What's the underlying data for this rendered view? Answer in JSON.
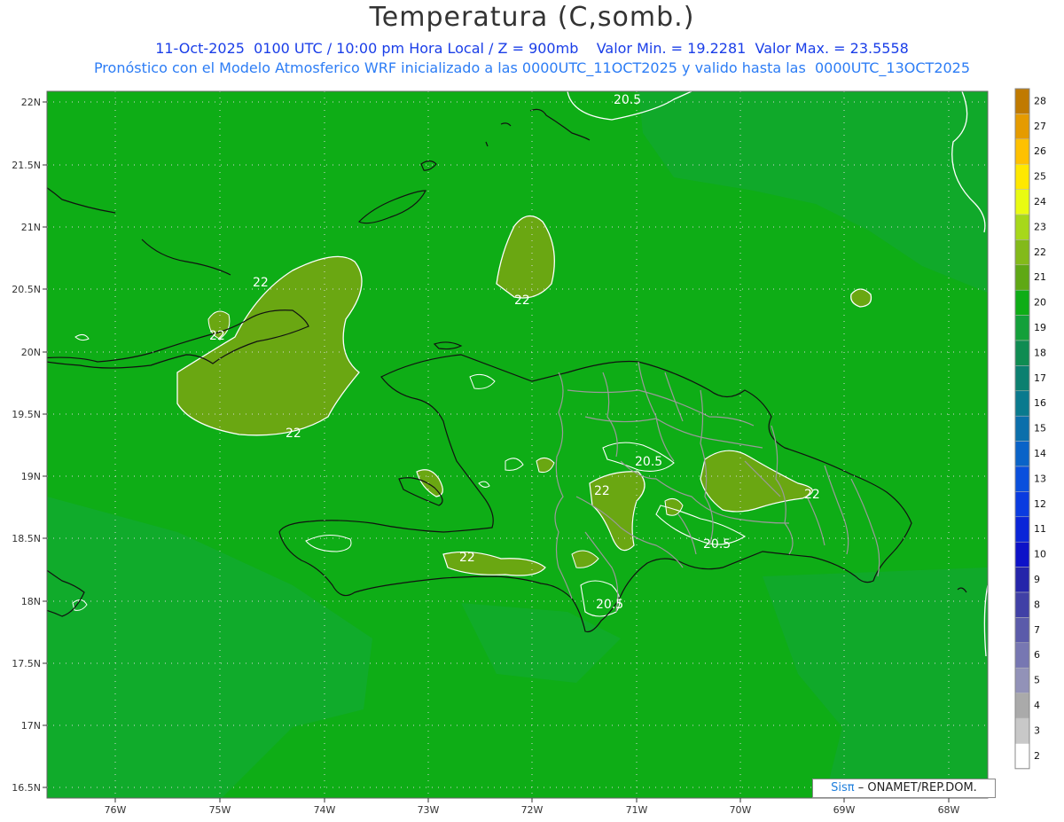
{
  "title": "Temperatura (C,somb.)",
  "subtitle_line1": "11-Oct-2025  0100 UTC / 10:00 pm Hora Local / Z = 900mb    Valor Min. = 19.2281  Valor Max. = 23.5558",
  "subtitle_line2": "Pronóstico con el Modelo Atmosferico WRF inicializado a las 0000UTC_11OCT2025 y valido hasta las  0000UTC_13OCT2025",
  "credit": {
    "sis": "Sisπ",
    "rest": "– ONAMET/REP.DOM."
  },
  "map": {
    "lon_range": [
      -76.65,
      -67.6
    ],
    "lat_range": [
      16.4,
      22.05
    ],
    "lat_ticks": [
      "22N",
      "21.5N",
      "21N",
      "20.5N",
      "20N",
      "19.5N",
      "19N",
      "18.5N",
      "18N",
      "17.5N",
      "17N",
      "16.5N"
    ],
    "lon_ticks": [
      "76W",
      "75W",
      "74W",
      "73W",
      "72W",
      "71W",
      "70W",
      "69W",
      "68W"
    ],
    "contour_labels": [
      "20.5",
      "22",
      "22",
      "22",
      "22",
      "20.5",
      "22",
      "22",
      "20.5",
      "22",
      "20.5"
    ],
    "colors": {
      "background_field": "#0ead16",
      "field_22plus": "#6aa712",
      "field_cool": "#17a546",
      "contour": "#ffffff",
      "coast": "#111111",
      "provinces": "#9a9a9a"
    }
  },
  "colorbar": {
    "labels": [
      "28",
      "27",
      "26",
      "25",
      "24",
      "23",
      "22",
      "21",
      "20",
      "19",
      "18",
      "17",
      "16",
      "15",
      "14",
      "13",
      "12",
      "11",
      "10",
      "9",
      "8",
      "7",
      "6",
      "5",
      "4",
      "3",
      "2"
    ],
    "colors": [
      "#c07a00",
      "#e59b00",
      "#ffc100",
      "#ffe800",
      "#e9fb12",
      "#a7d81a",
      "#83ba1a",
      "#5fa815",
      "#0ead16",
      "#13a03a",
      "#0f8c52",
      "#0c8070",
      "#0a7a8e",
      "#0b6fab",
      "#0a63c8",
      "#0a4fdd",
      "#0a3be0",
      "#0a25d8",
      "#0d12c8",
      "#2525aa",
      "#4040a6",
      "#5b5baa",
      "#7777b2",
      "#9292b8",
      "#aaaaaa",
      "#c8c8c8",
      "#ffffff"
    ]
  }
}
